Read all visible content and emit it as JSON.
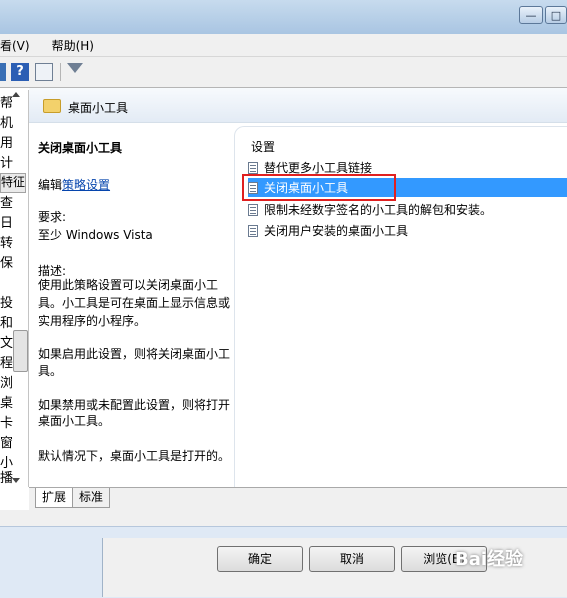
{
  "menubar": {
    "items": [
      "看(V)",
      "帮助(H)"
    ]
  },
  "tree": {
    "chars": [
      "帮",
      "机",
      "用",
      "计",
      "查",
      "日",
      "转",
      "保",
      "投",
      "和",
      "文",
      "程",
      "浏",
      "桌",
      "卡",
      "窗",
      "小",
      "播"
    ],
    "selected": "特征"
  },
  "main": {
    "folder_title": "桌面小工具",
    "policy_title": "关闭桌面小工具",
    "edit_prefix": "编辑",
    "edit_link": "策略设置",
    "req_label": "要求:",
    "req_value": "至少 Windows Vista",
    "desc_label": "描述:",
    "desc_lines": [
      "使用此策略设置可以关闭桌面小工",
      "具。小工具是可在桌面上显示信息或",
      "实用程序的小程序。"
    ],
    "enabled_lines": [
      "如果启用此设置，则将关闭桌面小工",
      "具。"
    ],
    "disabled_lines": [
      "如果禁用或未配置此设置，则将打开",
      "桌面小工具。"
    ],
    "default_line": "默认情况下，桌面小工具是打开的。"
  },
  "settings": {
    "header": "设置",
    "items": [
      "替代更多小工具链接",
      "关闭桌面小工具",
      "限制未经数字签名的小工具的解包和安装。",
      "关闭用户安装的桌面小工具"
    ]
  },
  "tabs": [
    "扩展",
    "标准"
  ],
  "buttons": {
    "ok": "确定",
    "cancel": "取消",
    "browse": "浏览(B)"
  },
  "watermark": "Bai经验"
}
